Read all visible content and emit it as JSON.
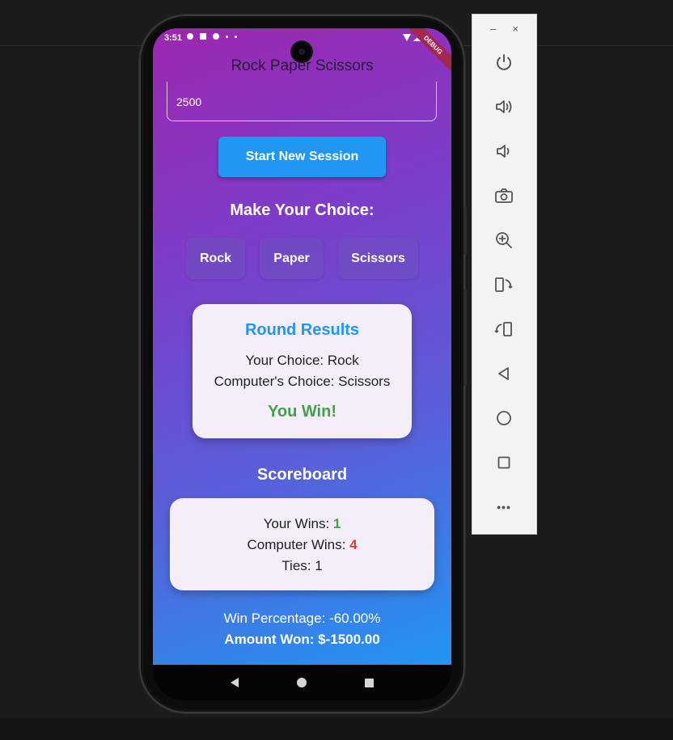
{
  "app": {
    "title": "Rock Paper Scissors",
    "status_time": "3:51",
    "debug_banner": "DEBUG"
  },
  "bet_field": {
    "value": "2500"
  },
  "start_button": {
    "label": "Start New Session"
  },
  "choices": {
    "heading": "Make Your Choice:",
    "options": [
      "Rock",
      "Paper",
      "Scissors"
    ]
  },
  "round_results": {
    "title": "Round Results",
    "your_choice": "Your Choice: Rock",
    "computer_choice": "Computer's Choice: Scissors",
    "outcome": "You Win!"
  },
  "scoreboard": {
    "title": "Scoreboard",
    "your_wins_label": "Your Wins: ",
    "your_wins": "1",
    "computer_wins_label": "Computer Wins: ",
    "computer_wins": "4",
    "ties": "Ties: 1"
  },
  "stats": {
    "win_percentage": "Win Percentage: -60.00%",
    "amount_won": "Amount Won: $-1500.00"
  },
  "toolbar": {
    "minimize": "–",
    "close": "×",
    "more": "•••"
  },
  "colors": {
    "gradient_start": "#9c27b0",
    "gradient_end": "#2196f3",
    "accent_blue": "#2196f3",
    "win_green": "#43a047",
    "loss_red": "#e53935"
  }
}
